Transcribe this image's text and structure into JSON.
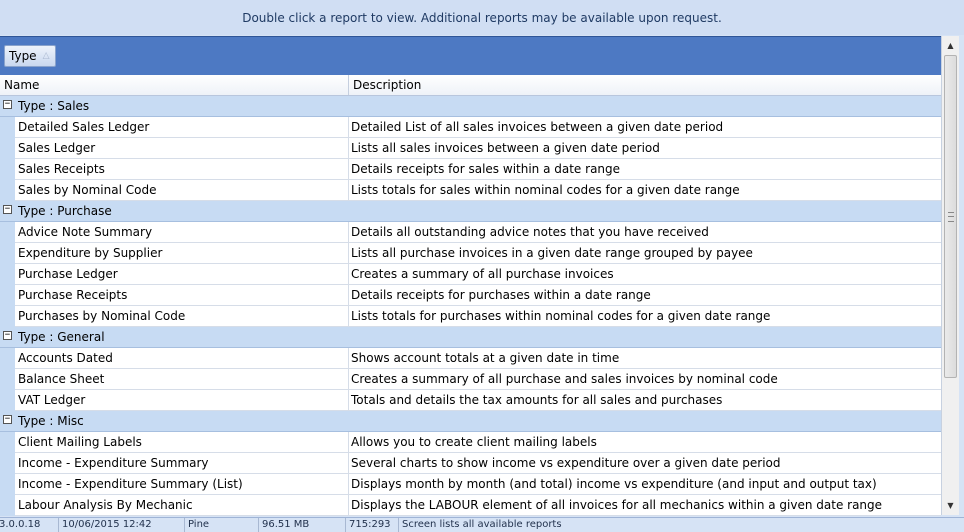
{
  "banner": {
    "text": "Double click a report to view.  Additional reports may be available upon request."
  },
  "group_panel": {
    "chip_label": "Type",
    "sort_icon": "sort-ascending-icon"
  },
  "columns": {
    "name": "Name",
    "description": "Description"
  },
  "groups": [
    {
      "label": "Type : Sales",
      "toggle": "⊟",
      "rows": [
        {
          "name": "Detailed Sales Ledger",
          "desc": "Detailed List of all sales invoices between a given date period"
        },
        {
          "name": "Sales Ledger",
          "desc": "Lists all sales invoices between a given date period"
        },
        {
          "name": "Sales Receipts",
          "desc": "Details receipts for sales within a date range"
        },
        {
          "name": "Sales by Nominal Code",
          "desc": "Lists totals for sales within nominal codes for a given date range"
        }
      ]
    },
    {
      "label": "Type : Purchase",
      "toggle": "⊟",
      "rows": [
        {
          "name": "Advice Note Summary",
          "desc": "Details all outstanding advice notes that you have received"
        },
        {
          "name": "Expenditure by Supplier",
          "desc": "Lists all purchase invoices in a given date range grouped by payee"
        },
        {
          "name": "Purchase Ledger",
          "desc": "Creates a summary of all purchase invoices"
        },
        {
          "name": "Purchase Receipts",
          "desc": "Details receipts for purchases within a date range"
        },
        {
          "name": "Purchases by Nominal Code",
          "desc": "Lists totals for purchases within nominal codes for a given date range"
        }
      ]
    },
    {
      "label": "Type : General",
      "toggle": "⊟",
      "rows": [
        {
          "name": "Accounts Dated",
          "desc": "Shows account totals at a given date in time"
        },
        {
          "name": "Balance Sheet",
          "desc": "Creates a summary of all purchase and sales invoices by nominal code"
        },
        {
          "name": "VAT Ledger",
          "desc": "Totals and details the tax amounts for all sales and purchases"
        }
      ]
    },
    {
      "label": "Type : Misc",
      "toggle": "⊟",
      "rows": [
        {
          "name": "Client Mailing Labels",
          "desc": "Allows you to create client mailing labels"
        },
        {
          "name": "Income - Expenditure Summary",
          "desc": "Several charts to show income vs expenditure over a given date period"
        },
        {
          "name": "Income - Expenditure Summary (List)",
          "desc": "Displays month by month (and total) income vs expenditure (and input and output tax)"
        },
        {
          "name": "Labour Analysis By Mechanic",
          "desc": "Displays the LABOUR element of all invoices for all mechanics within a given date range"
        }
      ]
    }
  ],
  "scrollbar": {
    "up_icon": "▲",
    "down_icon": "▼",
    "position": 0.0
  },
  "status": {
    "version": "3.0.0.18",
    "datetime": "10/06/2015 12:42",
    "user": "Pine",
    "memory": "96.51 MB",
    "size": "715:293",
    "message": "Screen lists all available reports"
  }
}
